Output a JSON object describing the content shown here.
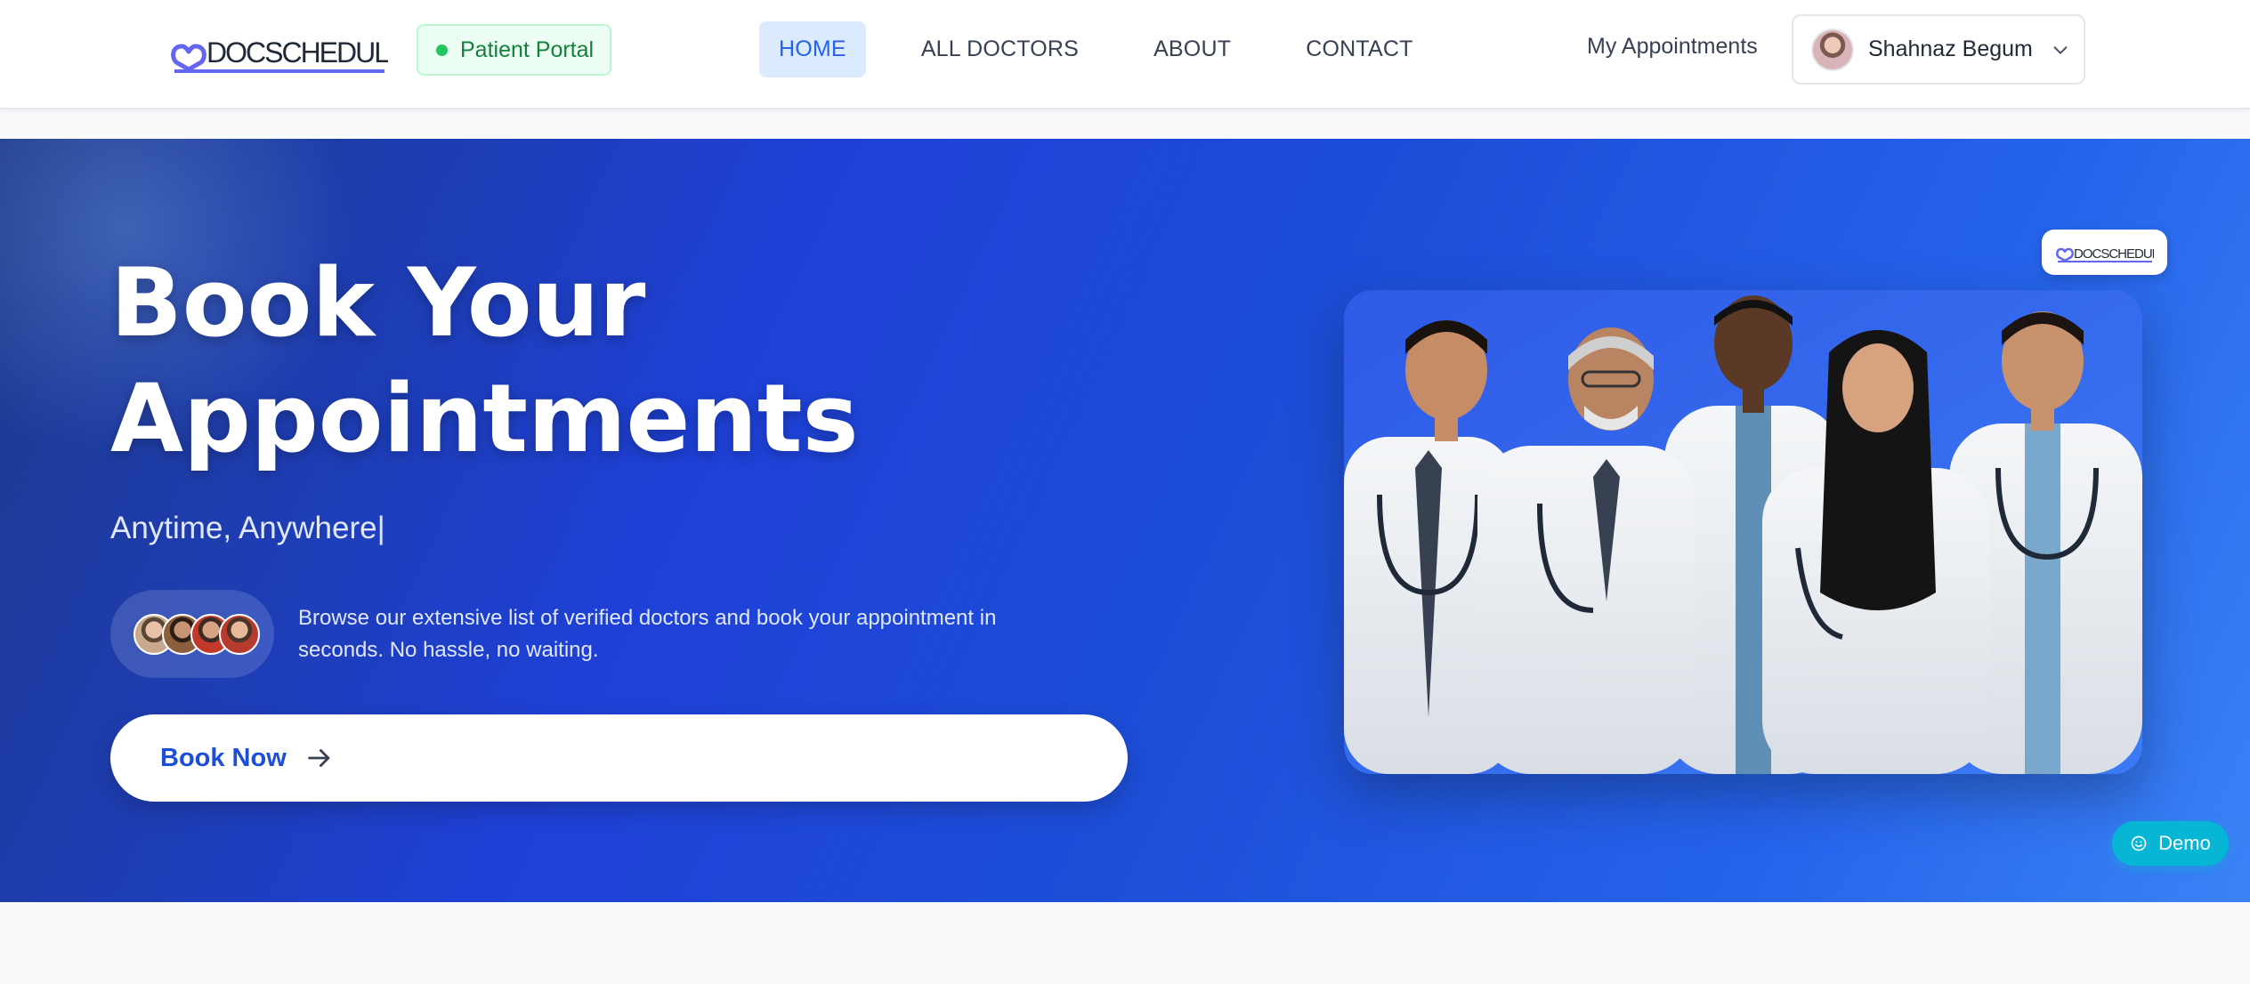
{
  "brand": {
    "logo_text": "DOCSCHEDULE",
    "portal_badge": "Patient Portal"
  },
  "nav": {
    "items": [
      {
        "label": "HOME",
        "active": true
      },
      {
        "label": "ALL DOCTORS",
        "active": false
      },
      {
        "label": "ABOUT",
        "active": false
      },
      {
        "label": "CONTACT",
        "active": false
      }
    ],
    "my_appointments": "My Appointments",
    "user_name": "Shahnaz Begum",
    "user_menu_icon": "chevron-down-icon"
  },
  "hero": {
    "title_line1": "Book Your",
    "title_line2": "Appointments",
    "subtitle": "Anytime, Anywhere|",
    "description": "Browse our extensive list of verified doctors and book your appointment in seconds. No hassle, no waiting.",
    "cta_label": "Book Now",
    "cta_icon": "arrow-right-icon",
    "demo_label": "Demo",
    "demo_icon": "smile-icon"
  },
  "colors": {
    "accent": "#2563eb",
    "hero_start": "#1e3a8a",
    "hero_end": "#3b82f6",
    "portal_green": "#15803d",
    "demo_cyan": "#06b6d4"
  }
}
